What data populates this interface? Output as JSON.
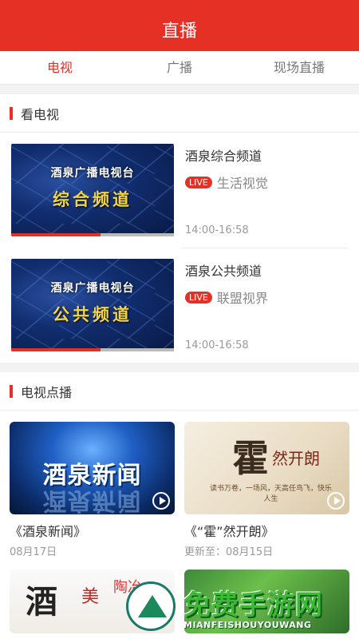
{
  "header": {
    "title": "直播"
  },
  "tabs": [
    {
      "label": "电视",
      "active": true
    },
    {
      "label": "广播",
      "active": false
    },
    {
      "label": "现场直播",
      "active": false
    }
  ],
  "tv_section": {
    "title": "看电视",
    "items": [
      {
        "station": "酒泉广播电视台",
        "channel_art": "综合频道",
        "name": "酒泉综合频道",
        "badge": "LIVE",
        "program": "生活视觉",
        "time": "14:00-16:58"
      },
      {
        "station": "酒泉广播电视台",
        "channel_art": "公共频道",
        "name": "酒泉公共频道",
        "badge": "LIVE",
        "program": "联盟视界",
        "time": "14:00-16:58"
      }
    ]
  },
  "vod_section": {
    "title": "电视点播",
    "items": [
      {
        "art": "酒泉新闻",
        "title": "《酒泉新闻》",
        "date": "08月17日"
      },
      {
        "art_big": "霍",
        "art_small": "然开朗",
        "art_line": "读书万卷，一场风，天高任鸟飞，快乐人生",
        "title": "《“霍”然开朗》",
        "date": "更新至：08月15日"
      }
    ]
  },
  "partial_cards": [
    {
      "art_1": "酒",
      "art_2": "美",
      "art_3": "陶冶"
    },
    {}
  ],
  "watermark": {
    "text": "免费手游网",
    "sub": "MIANFEISHOUYOUWANG"
  },
  "colors": {
    "brand_red": "#e53026",
    "watermark_green": "#3fb838"
  }
}
